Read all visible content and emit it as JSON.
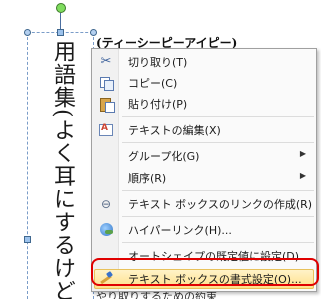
{
  "document": {
    "vertical_text": "用語集(よく耳にするけど?",
    "heading_line": "(ティーシーピーアイピー)",
    "right_fragments": [
      "、",
      "、"
    ],
    "bottom_fragment": "やり取りするための約束"
  },
  "context_menu": {
    "items": [
      {
        "label": "切り取り(T)",
        "icon": "scissors-icon",
        "submenu": false
      },
      {
        "label": "コピー(C)",
        "icon": "copy-icon",
        "submenu": false
      },
      {
        "label": "貼り付け(P)",
        "icon": "paste-icon",
        "submenu": false
      },
      {
        "label": "テキストの編集(X)",
        "icon": "edit-text-icon",
        "submenu": false
      },
      {
        "label": "グループ化(G)",
        "icon": "",
        "submenu": true
      },
      {
        "label": "順序(R)",
        "icon": "",
        "submenu": true
      },
      {
        "label": "テキスト ボックスのリンクの作成(R)",
        "icon": "link-icon",
        "submenu": false
      },
      {
        "label": "ハイパーリンク(H)...",
        "icon": "hyperlink-icon",
        "submenu": false
      },
      {
        "label": "オートシェイプの既定値に設定(D)",
        "icon": "",
        "submenu": false
      },
      {
        "label": "テキスト ボックスの書式設定(O)...",
        "icon": "format-icon",
        "submenu": false
      }
    ],
    "submenu_arrow": "▶",
    "highlight_color": "#ffe08a",
    "callout_color": "#e00000"
  }
}
